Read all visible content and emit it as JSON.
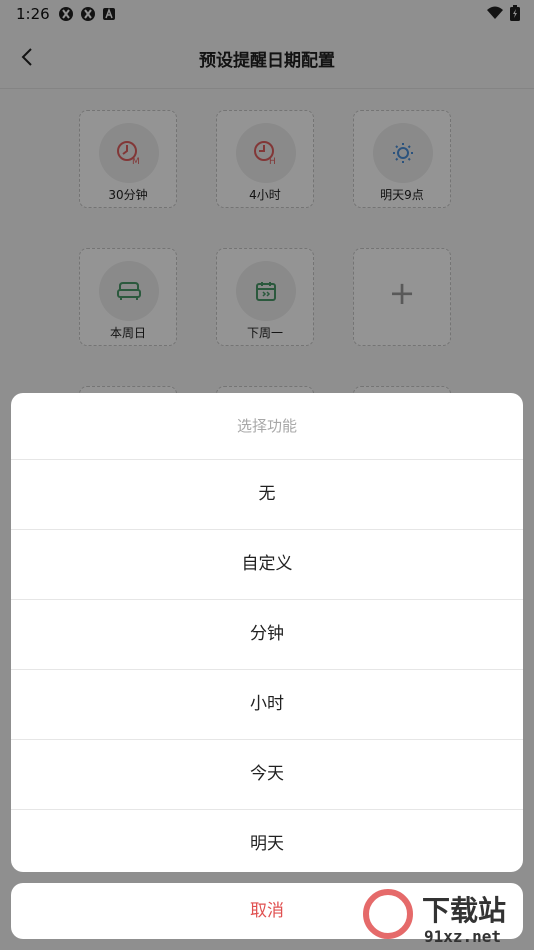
{
  "status": {
    "time": "1:26"
  },
  "header": {
    "title": "预设提醒日期配置"
  },
  "grid": {
    "items": [
      {
        "label": "30分钟",
        "icon": "clock-m-icon"
      },
      {
        "label": "4小时",
        "icon": "clock-h-icon"
      },
      {
        "label": "明天9点",
        "icon": "sun-icon"
      },
      {
        "label": "本周日",
        "icon": "sofa-icon"
      },
      {
        "label": "下周一",
        "icon": "calendar-icon"
      },
      {
        "label": "",
        "icon": "plus-icon"
      }
    ],
    "plus_symbol": "+"
  },
  "sheet": {
    "title": "选择功能",
    "options": [
      "无",
      "自定义",
      "分钟",
      "小时",
      "今天",
      "明天"
    ],
    "cancel_label": "取消"
  },
  "watermark": {
    "brand": "下载站",
    "domain": "91xz.net"
  },
  "colors": {
    "red_icon": "#e06060",
    "blue_icon": "#4a8fd9",
    "green_icon": "#4a9a6a",
    "cancel": "#e05050"
  }
}
